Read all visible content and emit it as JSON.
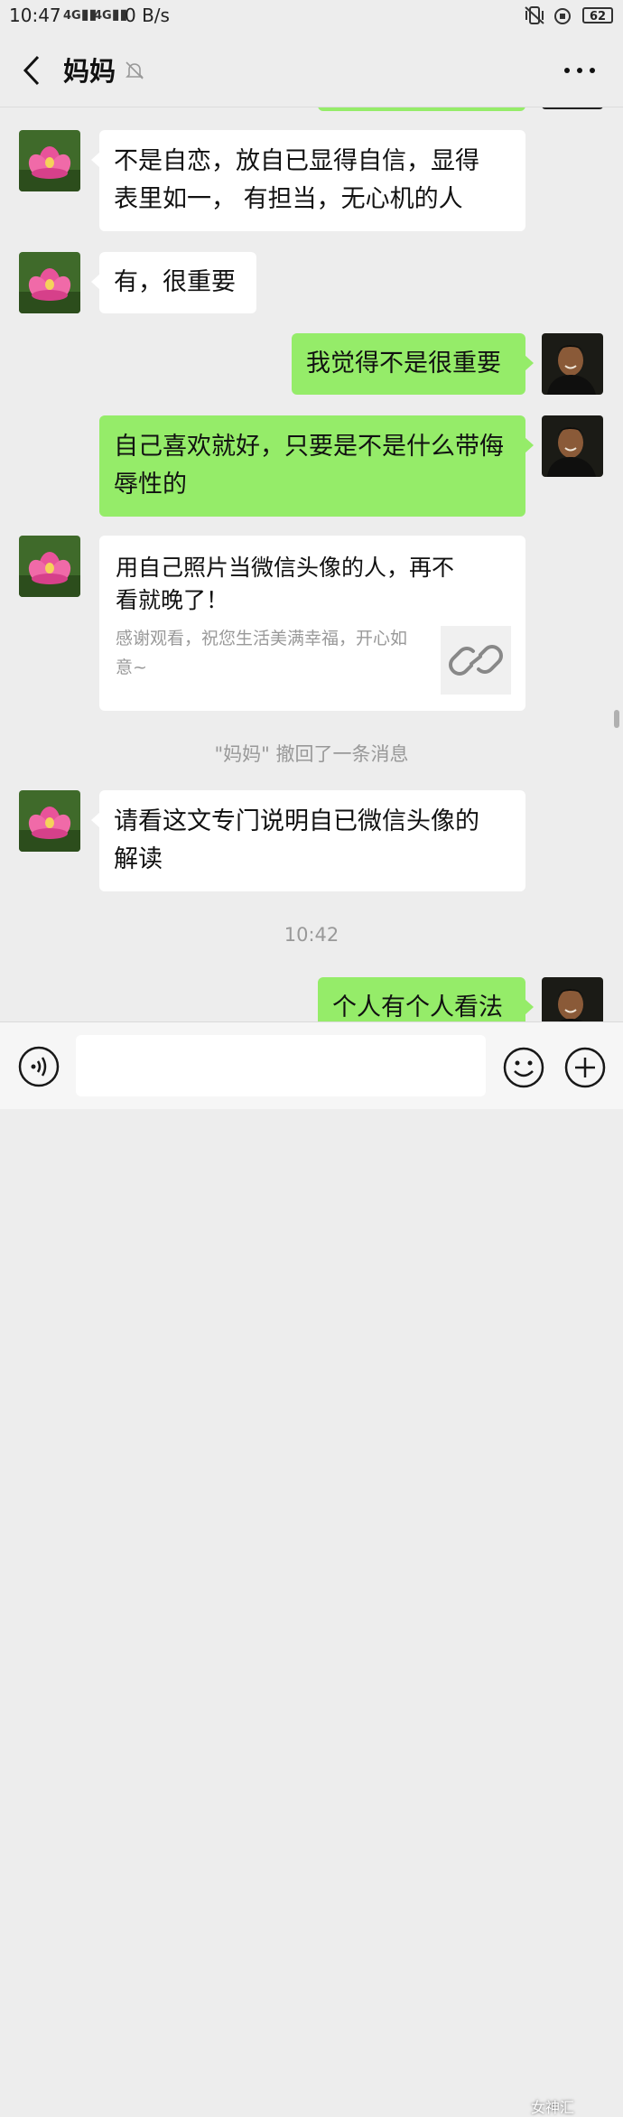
{
  "status_bar": {
    "time": "10:47",
    "signal_left": "4G",
    "signal_right": "4G",
    "net_speed": "0 B/s",
    "battery": "62"
  },
  "header": {
    "back_icon": "chevron-left-icon",
    "title": "妈妈",
    "mute_icon": "bell-slash-icon",
    "more_icon": "ellipsis-icon"
  },
  "messages": [
    {
      "from": "mother",
      "type": "text",
      "lines": [
        "不是自恋，放自已显得自信，显得",
        "表里如一， 有担当，无心机的人"
      ]
    },
    {
      "from": "mother",
      "type": "text",
      "lines": [
        "有，很重要"
      ]
    },
    {
      "from": "me",
      "type": "text",
      "lines": [
        "我觉得不是很重要"
      ]
    },
    {
      "from": "me",
      "type": "text",
      "lines": [
        "自己喜欢就好，只要是不是什么带侮",
        "辱性的"
      ]
    },
    {
      "from": "mother",
      "type": "link",
      "title": [
        "用自己照片当微信头像的人，再不",
        "看就晚了！"
      ],
      "desc": [
        "感谢观看，祝您生活美满幸福，开心如",
        "意~"
      ],
      "thumb_icon": "link-icon"
    },
    {
      "from": "system",
      "type": "recall",
      "text": "\"妈妈\" 撤回了一条消息"
    },
    {
      "from": "mother",
      "type": "text",
      "lines": [
        "请看这文专门说明自已微信头像的",
        "解读"
      ]
    },
    {
      "from": "system",
      "type": "time",
      "text": "10:42"
    },
    {
      "from": "me",
      "type": "text",
      "lines": [
        "个人有个人看法"
      ]
    }
  ],
  "input_bar": {
    "voice_icon": "voice-icon",
    "placeholder": "",
    "emoji_icon": "emoji-icon",
    "plus_icon": "plus-icon"
  },
  "watermark": "女神汇",
  "colors": {
    "background": "#ededed",
    "my_bubble": "#95ec69",
    "their_bubble": "#ffffff"
  }
}
